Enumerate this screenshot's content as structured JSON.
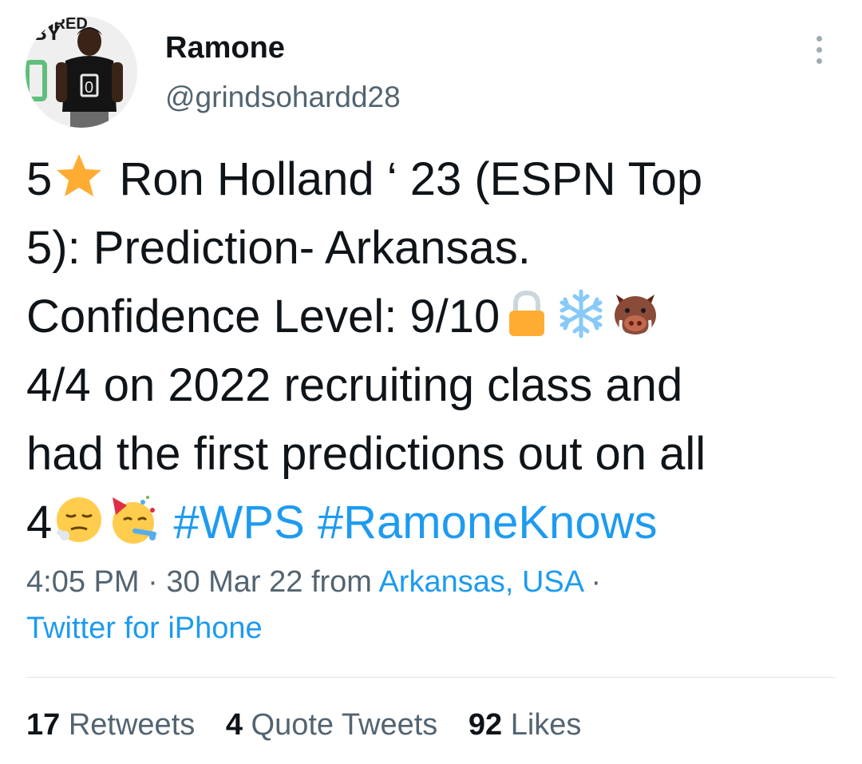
{
  "user": {
    "display_name": "Ramone",
    "handle": "@grindsohardd28"
  },
  "tweet": {
    "lines": [
      {
        "a": "5",
        "b": " Ron Holland ‘ 23 (ESPN Top"
      },
      {
        "a": "5): Prediction- Arkansas."
      },
      {
        "a": "Confidence Level: 9/10"
      },
      {
        "a": "4/4 on 2022 recruiting class and"
      },
      {
        "a": "had the first predictions out on all"
      },
      {
        "a": "4"
      }
    ],
    "hashtags": [
      "#WPS",
      "#RamoneKnows"
    ],
    "emojis": [
      "star-emoji",
      "lock-emoji",
      "snowflake-emoji",
      "boar-emoji",
      "relieved-face-emoji",
      "party-face-emoji"
    ]
  },
  "meta": {
    "time": "4:05 PM",
    "sep1": " · ",
    "date": "30 Mar 22",
    "from": " from ",
    "location": "Arkansas, USA",
    "sep2": " ·",
    "client": "Twitter for iPhone"
  },
  "stats": {
    "retweets_count": "17",
    "retweets_label": "Retweets",
    "quotes_count": "4",
    "quotes_label": "Quote Tweets",
    "likes_count": "92",
    "likes_label": "Likes"
  },
  "colors": {
    "link": "#1d9bf0",
    "secondary_text": "#536471",
    "primary_text": "#0f1419"
  }
}
